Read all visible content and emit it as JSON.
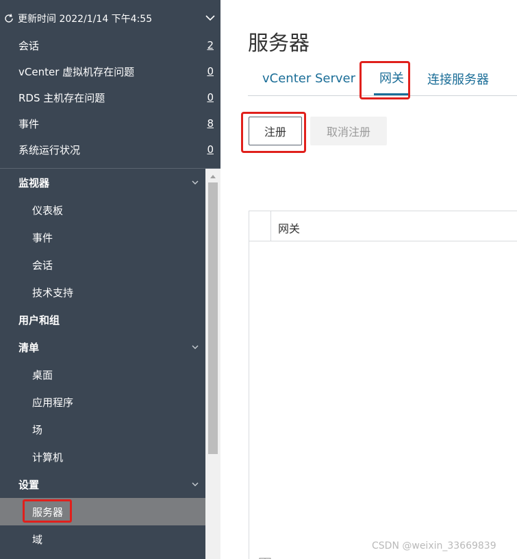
{
  "status_panel": {
    "refresh_label": "更新时间 2022/1/14 下午4:55",
    "rows": [
      {
        "label": "会话",
        "count": "2"
      },
      {
        "label": "vCenter 虚拟机存在问题",
        "count": "0"
      },
      {
        "label": "RDS 主机存在问题",
        "count": "0"
      },
      {
        "label": "事件",
        "count": "8"
      },
      {
        "label": "系统运行状况",
        "count": "0"
      }
    ]
  },
  "nav": {
    "monitor": {
      "label": "监视器",
      "children": [
        "仪表板",
        "事件",
        "会话",
        "技术支持"
      ]
    },
    "users_groups": {
      "label": "用户和组"
    },
    "inventory": {
      "label": "清单",
      "children": [
        "桌面",
        "应用程序",
        "场",
        "计算机"
      ]
    },
    "settings": {
      "label": "设置",
      "children": [
        "服务器",
        "域"
      ]
    }
  },
  "main": {
    "title": "服务器",
    "tabs": [
      "vCenter Server",
      "网关",
      "连接服务器"
    ],
    "active_tab": "网关",
    "buttons": {
      "register": "注册",
      "unregister": "取消注册"
    },
    "grid": {
      "column": "网关"
    }
  },
  "watermark": "CSDN @weixin_33669839",
  "colors": {
    "sidebar_bg": "#3b4653",
    "accent": "#1a6d97",
    "highlight": "#e0201c"
  }
}
